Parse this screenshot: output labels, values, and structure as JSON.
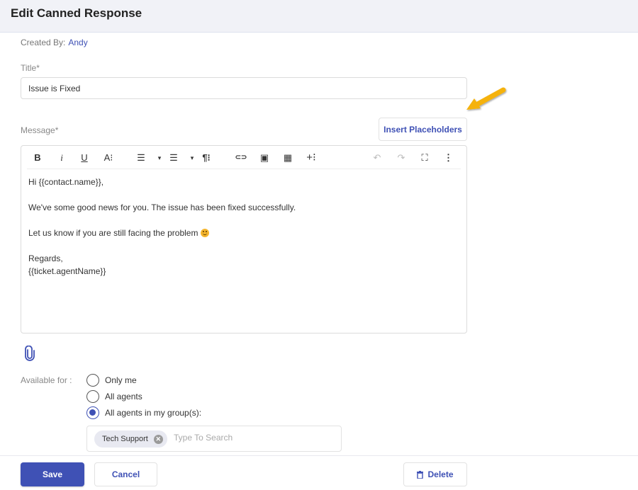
{
  "header": {
    "title": "Edit Canned Response"
  },
  "meta": {
    "created_by_label": "Created By:",
    "created_by_name": "Andy"
  },
  "form": {
    "title_label": "Title*",
    "title_value": "Issue is Fixed",
    "message_label": "Message*",
    "insert_placeholders_label": "Insert Placeholders"
  },
  "toolbar": {
    "items": [
      {
        "icon": "bold-icon",
        "glyph": "B"
      },
      {
        "icon": "italic-icon",
        "glyph": "i"
      },
      {
        "icon": "underline-icon",
        "glyph": "U"
      },
      {
        "icon": "font-size-icon",
        "glyph": "A⁝"
      },
      {
        "icon": "ordered-list-icon",
        "glyph": "☰"
      },
      {
        "icon": "ordered-list-dropdown-icon",
        "glyph": "▾"
      },
      {
        "icon": "unordered-list-icon",
        "glyph": "☰"
      },
      {
        "icon": "unordered-list-dropdown-icon",
        "glyph": "▾"
      },
      {
        "icon": "paragraph-format-icon",
        "glyph": "¶⁝"
      },
      {
        "icon": "link-icon",
        "glyph": "⊂⊃"
      },
      {
        "icon": "image-icon",
        "glyph": "▣"
      },
      {
        "icon": "table-icon",
        "glyph": "▦"
      },
      {
        "icon": "insert-more-icon",
        "glyph": "+⁝"
      },
      {
        "icon": "undo-icon",
        "glyph": "↶"
      },
      {
        "icon": "redo-icon",
        "glyph": "↷"
      },
      {
        "icon": "fullscreen-icon",
        "glyph": "⛶"
      },
      {
        "icon": "more-options-icon",
        "glyph": "⋮"
      }
    ]
  },
  "message": {
    "greeting": "Hi {{contact.name}},",
    "line1": "We've some good news for you. The issue has been fixed successfully.",
    "line2": "Let us know if you are still facing the problem",
    "line2_emoji": "smiley-icon",
    "closing": "Regards,",
    "signature": "{{ticket.agentName}}"
  },
  "availability": {
    "label": "Available for :",
    "options": [
      {
        "label": "Only me",
        "checked": false
      },
      {
        "label": "All agents",
        "checked": false
      },
      {
        "label": "All agents in my group(s):",
        "checked": true
      }
    ],
    "groups": [
      "Tech Support"
    ],
    "search_placeholder": "Type To Search"
  },
  "footer": {
    "save_label": "Save",
    "cancel_label": "Cancel",
    "delete_label": "Delete"
  },
  "colors": {
    "accent": "#3f51b5",
    "header_bg": "#f1f2f7",
    "arrow": "#f5b20a"
  }
}
